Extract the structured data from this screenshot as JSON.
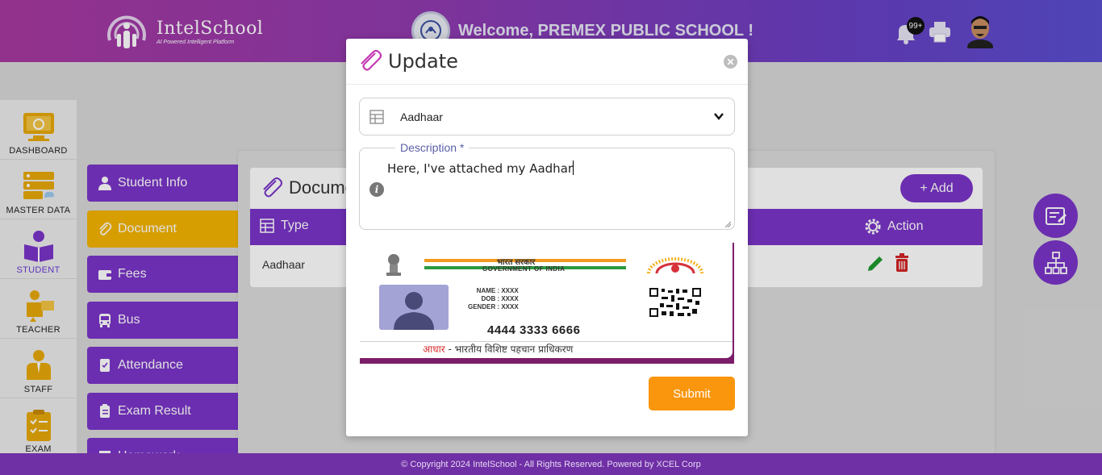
{
  "header": {
    "logo_name": "IntelSchool",
    "logo_tagline": "AI Powered Intelligent Platform",
    "welcome": "Welcome, PREMEX PUBLIC SCHOOL !",
    "notification_badge": "99+"
  },
  "sidebar": {
    "items": [
      {
        "label": "DASHBOARD",
        "icon": "dashboard-icon"
      },
      {
        "label": "MASTER DATA",
        "icon": "master-data-icon"
      },
      {
        "label": "STUDENT",
        "icon": "student-icon",
        "active": true
      },
      {
        "label": "TEACHER",
        "icon": "teacher-icon"
      },
      {
        "label": "STAFF",
        "icon": "staff-icon"
      },
      {
        "label": "EXAM",
        "icon": "exam-icon"
      }
    ]
  },
  "submenu": {
    "items": [
      {
        "label": "Student Info",
        "icon": "user-icon"
      },
      {
        "label": "Document",
        "icon": "paperclip-icon",
        "active": true
      },
      {
        "label": "Fees",
        "icon": "wallet-icon"
      },
      {
        "label": "Bus",
        "icon": "bus-icon"
      },
      {
        "label": "Attendance",
        "icon": "attendance-icon"
      },
      {
        "label": "Exam Result",
        "icon": "clipboard-icon"
      },
      {
        "label": "Homework",
        "icon": "homework-icon"
      }
    ]
  },
  "documents": {
    "title": "Documents",
    "add_label": "+ Add",
    "columns": {
      "type": "Type",
      "action": "Action"
    },
    "rows": [
      {
        "type": "Aadhaar"
      }
    ]
  },
  "modal": {
    "title": "Update",
    "document_type": "Aadhaar",
    "description_label": "Description *",
    "description_value": "Here, I've attached my Aadhar",
    "submit_label": "Submit",
    "card": {
      "hindi_top": "भारत सरकार",
      "goi": "GOVERNMENT OF INDIA",
      "name": "NAME : XXXX",
      "dob": "DOB : XXXX",
      "gender": "GENDER : XXXX",
      "number": "4444 3333 6666",
      "footer_red": "आधार",
      "footer_rest": " - भारतीय विशिष्ट पहचान प्राधिकरण"
    }
  },
  "footer": {
    "text": "© Copyright 2024 IntelSchool - All Rights Reserved. Powered by XCEL Corp"
  },
  "colors": {
    "primary": "#7a35c9",
    "accent": "#f4b400",
    "submit": "#f9960d",
    "edit": "#1f9a2e",
    "delete": "#d32626"
  }
}
